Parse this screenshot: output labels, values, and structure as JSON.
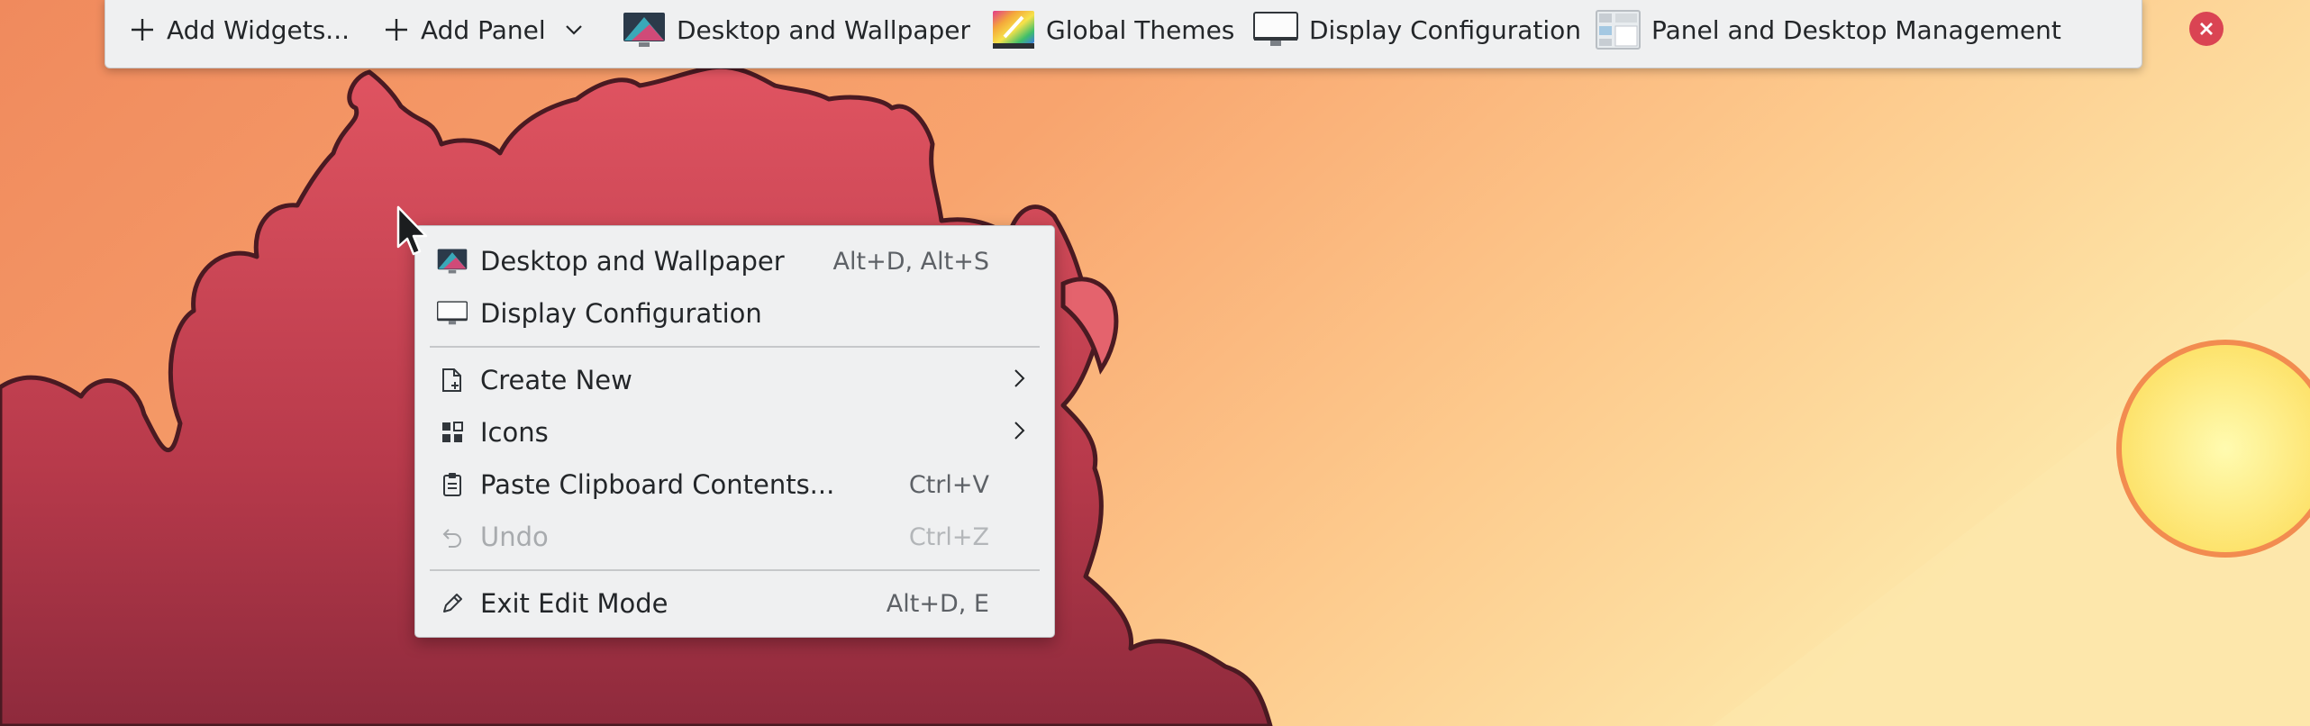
{
  "toolbar": {
    "add_widgets": "Add Widgets...",
    "add_panel": "Add Panel",
    "desktop_wallpaper": "Desktop and Wallpaper",
    "global_themes": "Global Themes",
    "display_configuration": "Display Configuration",
    "panel_desktop_management": "Panel and Desktop Management",
    "icons": {
      "add_widgets": "plus-icon",
      "add_panel": "plus-icon",
      "add_panel_dropdown": "chevron-down-icon",
      "desktop_wallpaper": "wallpaper-icon",
      "global_themes": "themes-icon",
      "display_configuration": "monitor-icon",
      "panel_desktop_management": "panel-management-icon",
      "close": "close-icon"
    },
    "close_color": "#da4453"
  },
  "context_menu": {
    "items": [
      {
        "label": "Desktop and Wallpaper",
        "shortcut": "Alt+D, Alt+S",
        "icon": "wallpaper-icon"
      },
      {
        "label": "Display Configuration",
        "shortcut": "",
        "icon": "monitor-icon"
      },
      {
        "label": "Create New",
        "shortcut": "",
        "icon": "new-document-icon",
        "submenu": true
      },
      {
        "label": "Icons",
        "shortcut": "",
        "icon": "grid-icon",
        "submenu": true
      },
      {
        "label": "Paste Clipboard Contents...",
        "shortcut": "Ctrl+V",
        "icon": "clipboard-icon"
      },
      {
        "label": "Undo",
        "shortcut": "Ctrl+Z",
        "icon": "undo-icon",
        "disabled": true
      },
      {
        "label": "Exit Edit Mode",
        "shortcut": "Alt+D, E",
        "icon": "pencil-icon"
      }
    ]
  },
  "colors": {
    "wallpaper_warm": "#f39a68",
    "wallpaper_light": "#fde2a0",
    "cloud": "#c8434f",
    "sun": "#fff18a",
    "menu_bg": "#eff0f1"
  }
}
